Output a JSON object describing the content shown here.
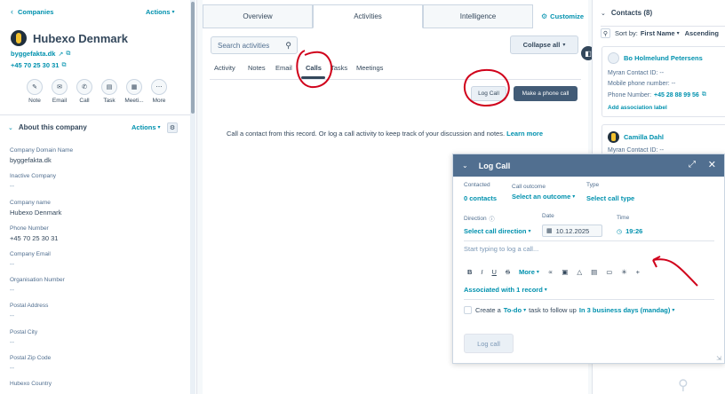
{
  "left": {
    "back_label": "Companies",
    "actions_label": "Actions",
    "company_name": "Hubexo Denmark",
    "domain": "byggefakta.dk",
    "phone": "+45 70 25 30 31",
    "quick_actions": [
      {
        "label": "Note",
        "icon": "edit-icon"
      },
      {
        "label": "Email",
        "icon": "mail-icon"
      },
      {
        "label": "Call",
        "icon": "phone-icon"
      },
      {
        "label": "Task",
        "icon": "task-icon"
      },
      {
        "label": "Meeti...",
        "icon": "calendar-icon"
      },
      {
        "label": "More",
        "icon": "more-icon"
      }
    ],
    "about_title": "About this company",
    "about_actions": "Actions",
    "properties": [
      {
        "label": "Company Domain Name",
        "value": "byggefakta.dk"
      },
      {
        "label": "Inactive Company",
        "value": "--"
      },
      {
        "label": "Company name",
        "value": "Hubexo Denmark"
      },
      {
        "label": "Phone Number",
        "value": "+45 70 25 30 31"
      },
      {
        "label": "Company Email",
        "value": "--"
      },
      {
        "label": "Organisation Number",
        "value": "--"
      },
      {
        "label": "Postal Address",
        "value": "--"
      },
      {
        "label": "Postal City",
        "value": "--"
      },
      {
        "label": "Postal Zip Code",
        "value": "--"
      },
      {
        "label": "Hubexo Country",
        "value": ""
      }
    ]
  },
  "middle": {
    "tabs": [
      "Overview",
      "Activities",
      "Intelligence"
    ],
    "customize_label": "Customize",
    "search_placeholder": "Search activities",
    "collapse_label": "Collapse all",
    "subtabs": [
      "Activity",
      "Notes",
      "Emails",
      "Calls",
      "Tasks",
      "Meetings"
    ],
    "subtab_email_visible": "Email",
    "log_call_label": "Log Call",
    "make_call_label": "Make a phone call",
    "empty_text": "Call a contact from this record. Or log a call activity to keep track of your discussion and notes.",
    "learn_more": "Learn more"
  },
  "right": {
    "contacts_title": "Contacts (8)",
    "sort_label": "Sort by:",
    "sort_field": "First Name",
    "sort_order": "Ascending",
    "contacts": [
      {
        "name": "Bo Holmelund Petersens",
        "myran_label": "Myran Contact ID:",
        "myran_value": "--",
        "mobile_label": "Mobile phone number:",
        "mobile_value": "--",
        "phone_label": "Phone Number:",
        "phone_value": "+45 28 88 99 56",
        "assoc_label": "Add association label"
      },
      {
        "name": "Camilla Dahl",
        "myran_label": "Myran Contact ID:",
        "myran_value": "--"
      }
    ]
  },
  "modal": {
    "title": "Log Call",
    "contacted_label": "Contacted",
    "contacted_value": "0 contacts",
    "outcome_label": "Call outcome",
    "outcome_value": "Select an outcome",
    "type_label": "Type",
    "type_value": "Select call type",
    "direction_label": "Direction",
    "direction_value": "Select call direction",
    "date_label": "Date",
    "date_value": "10.12.2025",
    "time_label": "Time",
    "time_value": "19:26",
    "editor_placeholder": "Start typing to log a call...",
    "format_more": "More",
    "associated_label": "Associated with 1 record",
    "followup_prefix": "Create a",
    "followup_type": "To-do",
    "followup_mid": "task to follow up",
    "followup_when": "In 3 business days (mandag)",
    "submit_label": "Log call"
  },
  "colors": {
    "accent": "#0091ae",
    "modal_header": "#516f90",
    "annotation": "#d0021b"
  }
}
